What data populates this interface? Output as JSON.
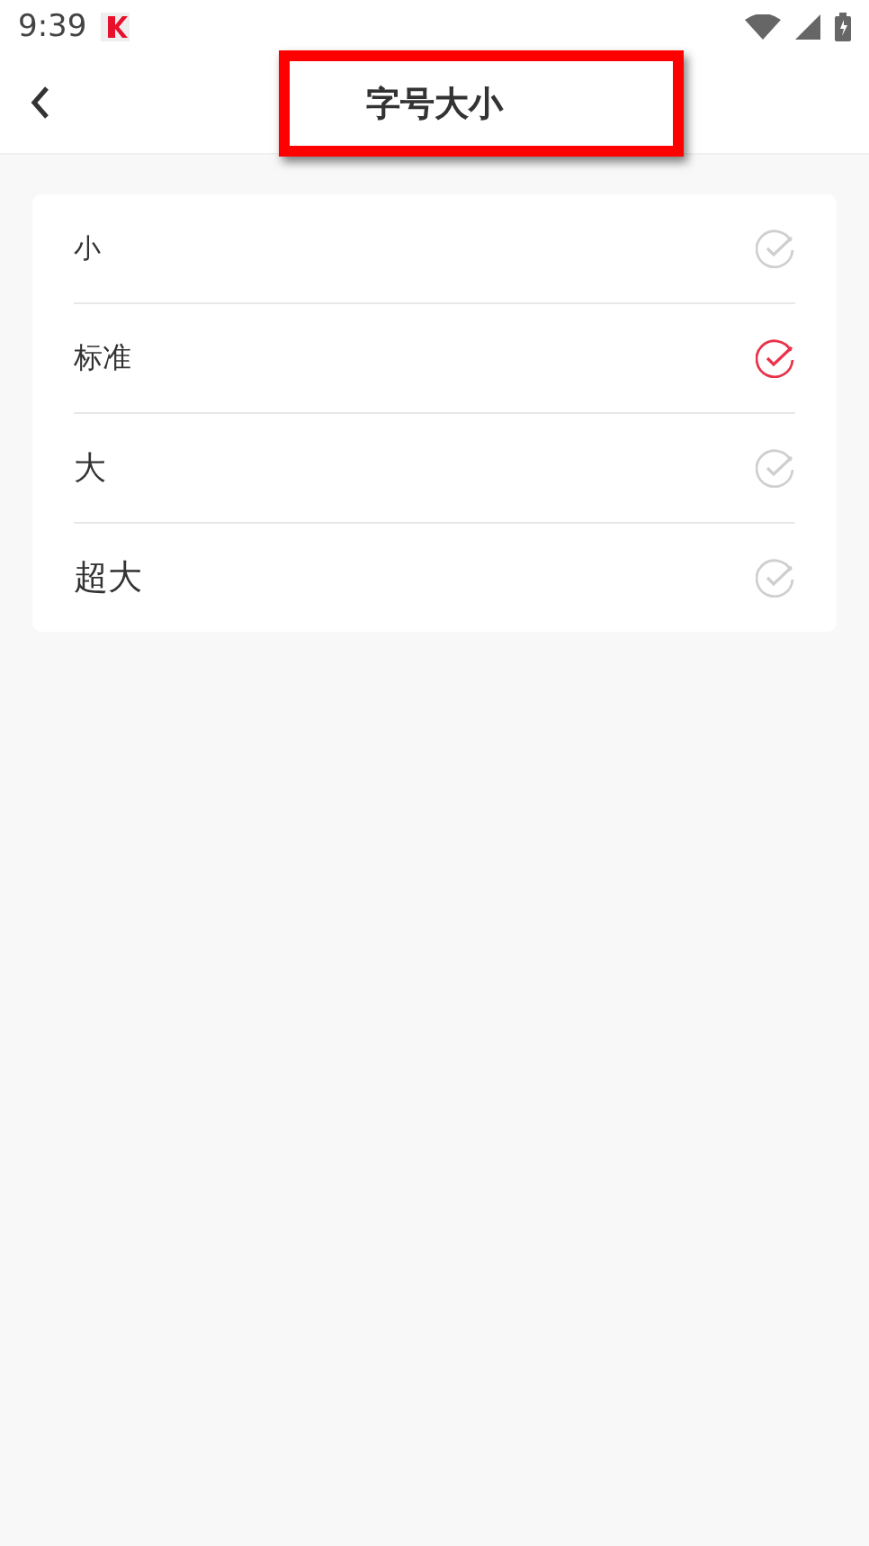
{
  "status_bar": {
    "time": "9:39"
  },
  "header": {
    "title": "字号大小",
    "highlighted": true
  },
  "options": [
    {
      "label": "小",
      "selected": false
    },
    {
      "label": "标准",
      "selected": true
    },
    {
      "label": "大",
      "selected": false
    },
    {
      "label": "超大",
      "selected": false
    }
  ]
}
